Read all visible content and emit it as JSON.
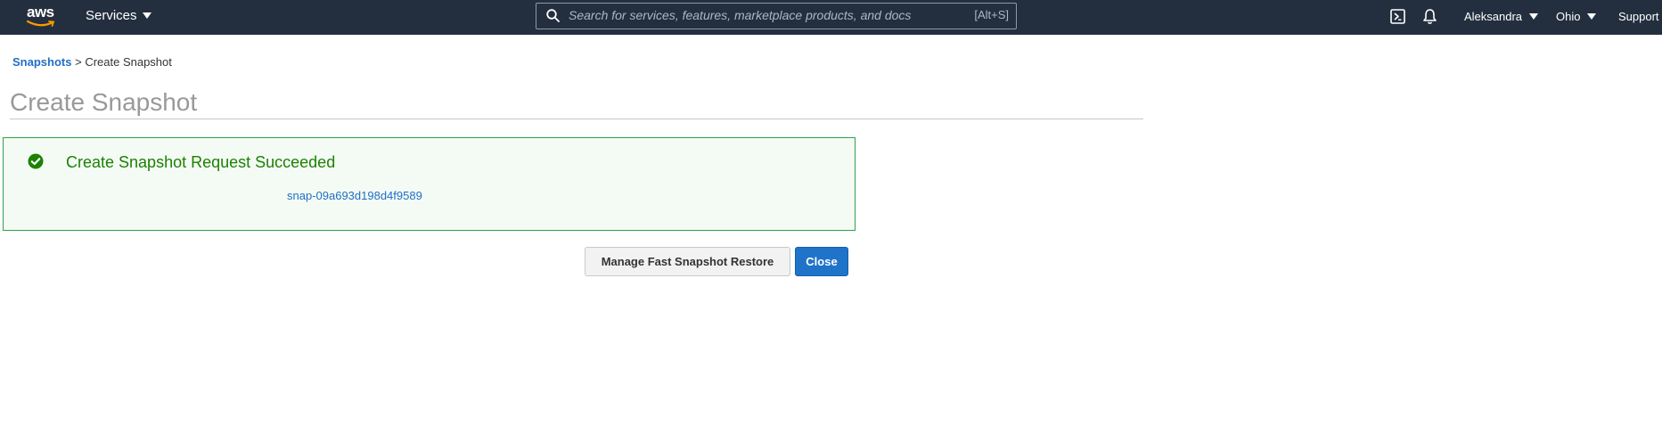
{
  "topnav": {
    "logo_text": "aws",
    "services_label": "Services",
    "search": {
      "placeholder": "Search for services, features, marketplace products, and docs",
      "shortcut": "[Alt+S]"
    },
    "user_label": "Aleksandra",
    "region_label": "Ohio",
    "support_label": "Support",
    "icons": [
      "cloudshell-icon",
      "bell-icon"
    ]
  },
  "breadcrumb": {
    "parent_label": "Snapshots",
    "separator": ">",
    "current_label": "Create Snapshot"
  },
  "page": {
    "title": "Create Snapshot"
  },
  "alert": {
    "type": "success",
    "title": "Create Snapshot Request Succeeded",
    "snapshot_id": "snap-09a693d198d4f9589"
  },
  "actions": {
    "manage_label": "Manage Fast Snapshot Restore",
    "close_label": "Close"
  },
  "colors": {
    "nav_bg": "#232f3e",
    "link_blue": "#1f6fc5",
    "success_green": "#1d8102",
    "primary_button": "#1f73c9"
  }
}
